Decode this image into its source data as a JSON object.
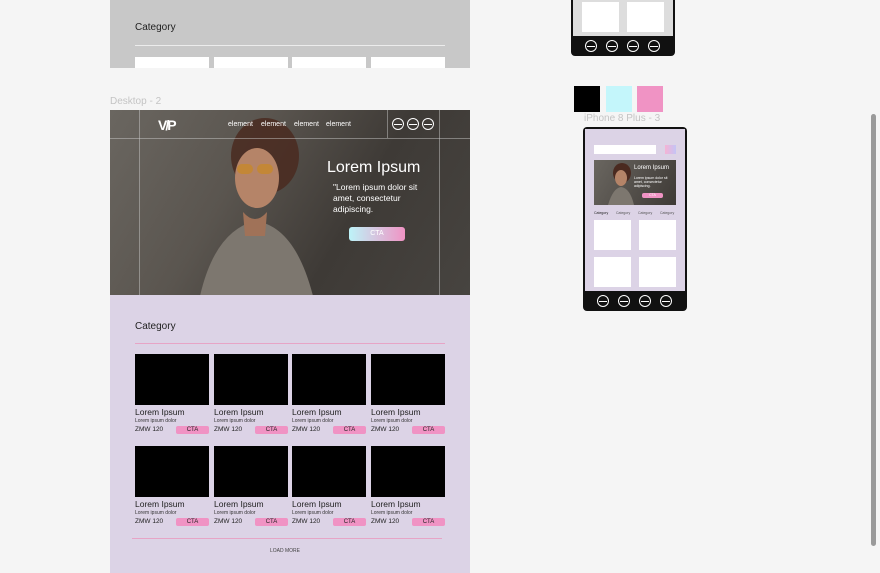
{
  "top_frame": {
    "category_title": "Category"
  },
  "desktop2": {
    "frame_label": "Desktop - 2",
    "logo": "V/P",
    "nav": [
      "element",
      "element",
      "element",
      "element"
    ],
    "hero": {
      "title": "Lorem Ipsum",
      "text": "\"Lorem ipsum dolor sit amet, consectetur adipiscing.",
      "cta": "CTA"
    },
    "category_title": "Category",
    "products": [
      {
        "name": "Lorem Ipsum",
        "desc": "Lorem ipsum dolor",
        "price": "ZMW 120",
        "cta": "CTA"
      },
      {
        "name": "Lorem Ipsum",
        "desc": "Lorem ipsum dolor",
        "price": "ZMW 120",
        "cta": "CTA"
      },
      {
        "name": "Lorem Ipsum",
        "desc": "Lorem ipsum dolor",
        "price": "ZMW 120",
        "cta": "CTA"
      },
      {
        "name": "Lorem Ipsum",
        "desc": "Lorem ipsum dolor",
        "price": "ZMW 120",
        "cta": "CTA"
      },
      {
        "name": "Lorem Ipsum",
        "desc": "Lorem ipsum dolor",
        "price": "ZMW 120",
        "cta": "CTA"
      },
      {
        "name": "Lorem Ipsum",
        "desc": "Lorem ipsum dolor",
        "price": "ZMW 120",
        "cta": "CTA"
      },
      {
        "name": "Lorem Ipsum",
        "desc": "Lorem ipsum dolor",
        "price": "ZMW 120",
        "cta": "CTA"
      },
      {
        "name": "Lorem Ipsum",
        "desc": "Lorem ipsum dolor",
        "price": "ZMW 120",
        "cta": "CTA"
      }
    ],
    "load_more": "LOAD MORE"
  },
  "swatches": [
    "#000000",
    "#c4f6fb",
    "#f093c4"
  ],
  "iphone3": {
    "frame_label": "iPhone 8 Plus - 3",
    "hero": {
      "title": "Lorem Ipsum",
      "text": "Lorem ipsum dolor sit amet, consectetur adipiscing.",
      "cta": "CTA"
    },
    "tabs": [
      "Category",
      "Category",
      "Category",
      "Category"
    ]
  },
  "colors": {
    "canvas": "#f5f5f5",
    "lavender": "#dcd3e6",
    "pink": "#f093c4",
    "cyan": "#c4f6fb",
    "gray_frame": "#c8c8c8"
  }
}
